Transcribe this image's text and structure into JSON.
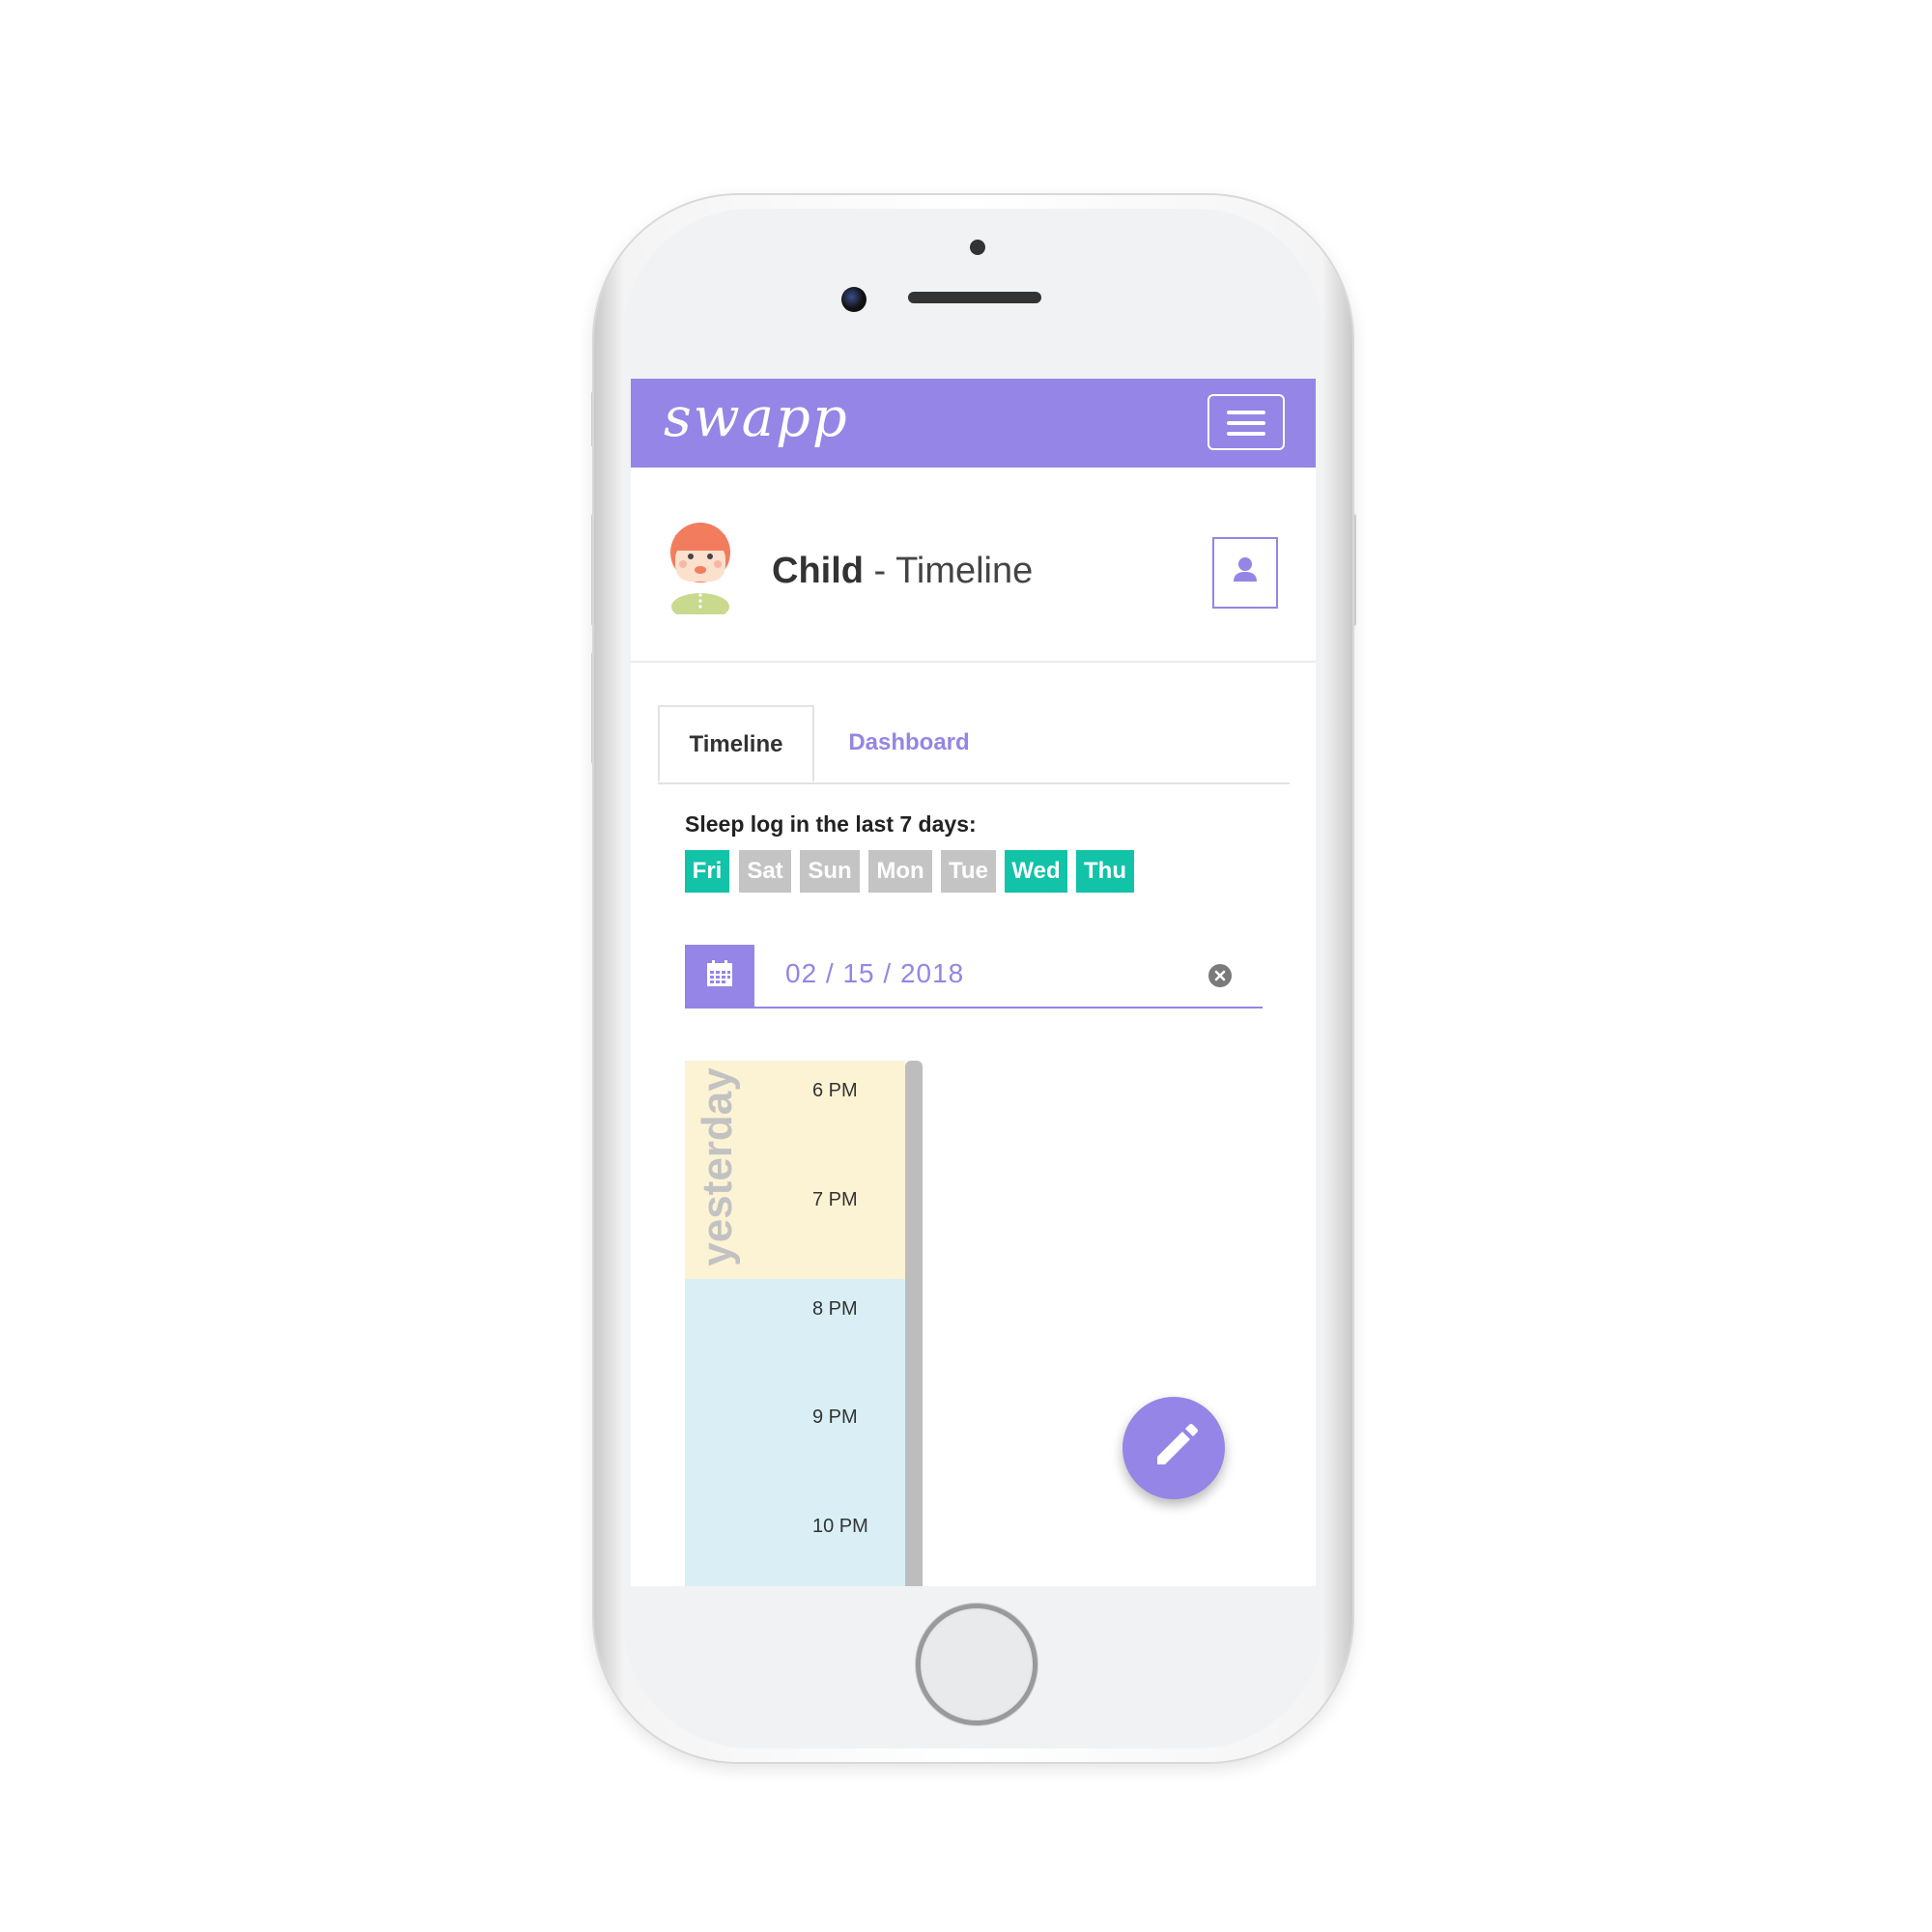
{
  "navbar": {
    "logo": "swapp",
    "menu_icon": "hamburger-menu-icon"
  },
  "profile": {
    "name": "Child",
    "separator": " - ",
    "page": "Timeline",
    "profile_icon": "user-icon"
  },
  "tabs": [
    {
      "label": "Timeline",
      "active": true
    },
    {
      "label": "Dashboard",
      "active": false
    }
  ],
  "sleep_log": {
    "label": "Sleep log in the last 7 days:",
    "days": [
      {
        "label": "Fri",
        "logged": true
      },
      {
        "label": "Sat",
        "logged": false
      },
      {
        "label": "Sun",
        "logged": false
      },
      {
        "label": "Mon",
        "logged": false
      },
      {
        "label": "Tue",
        "logged": false
      },
      {
        "label": "Wed",
        "logged": true
      },
      {
        "label": "Thu",
        "logged": true
      }
    ]
  },
  "date_picker": {
    "value": "02 / 15 / 2018",
    "calendar_icon": "calendar-icon",
    "clear_icon": "clear-icon"
  },
  "timeline": {
    "day_label": "yesterday",
    "hours": [
      "6 PM",
      "7 PM",
      "8 PM",
      "9 PM",
      "10 PM"
    ]
  },
  "fab": {
    "icon": "pencil-icon"
  },
  "colors": {
    "accent": "#9485e6",
    "logged_day": "#12c3a8",
    "unlogged_day": "#c4c4c4",
    "timeline_day": "#fcf3d4",
    "timeline_night": "#d9eff5"
  }
}
